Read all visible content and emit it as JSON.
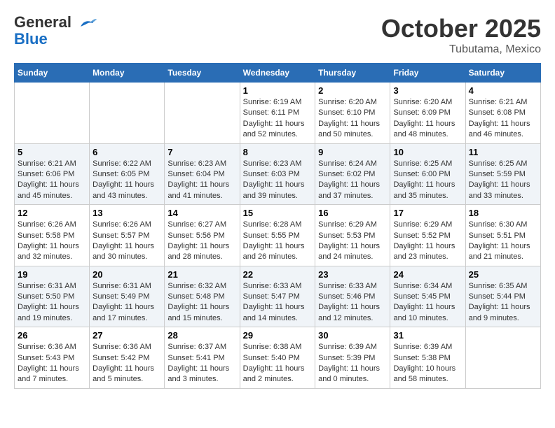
{
  "header": {
    "logo_line1": "General",
    "logo_line2": "Blue",
    "month": "October 2025",
    "location": "Tubutama, Mexico"
  },
  "weekdays": [
    "Sunday",
    "Monday",
    "Tuesday",
    "Wednesday",
    "Thursday",
    "Friday",
    "Saturday"
  ],
  "weeks": [
    [
      {
        "day": "",
        "info": ""
      },
      {
        "day": "",
        "info": ""
      },
      {
        "day": "",
        "info": ""
      },
      {
        "day": "1",
        "info": "Sunrise: 6:19 AM\nSunset: 6:11 PM\nDaylight: 11 hours\nand 52 minutes."
      },
      {
        "day": "2",
        "info": "Sunrise: 6:20 AM\nSunset: 6:10 PM\nDaylight: 11 hours\nand 50 minutes."
      },
      {
        "day": "3",
        "info": "Sunrise: 6:20 AM\nSunset: 6:09 PM\nDaylight: 11 hours\nand 48 minutes."
      },
      {
        "day": "4",
        "info": "Sunrise: 6:21 AM\nSunset: 6:08 PM\nDaylight: 11 hours\nand 46 minutes."
      }
    ],
    [
      {
        "day": "5",
        "info": "Sunrise: 6:21 AM\nSunset: 6:06 PM\nDaylight: 11 hours\nand 45 minutes."
      },
      {
        "day": "6",
        "info": "Sunrise: 6:22 AM\nSunset: 6:05 PM\nDaylight: 11 hours\nand 43 minutes."
      },
      {
        "day": "7",
        "info": "Sunrise: 6:23 AM\nSunset: 6:04 PM\nDaylight: 11 hours\nand 41 minutes."
      },
      {
        "day": "8",
        "info": "Sunrise: 6:23 AM\nSunset: 6:03 PM\nDaylight: 11 hours\nand 39 minutes."
      },
      {
        "day": "9",
        "info": "Sunrise: 6:24 AM\nSunset: 6:02 PM\nDaylight: 11 hours\nand 37 minutes."
      },
      {
        "day": "10",
        "info": "Sunrise: 6:25 AM\nSunset: 6:00 PM\nDaylight: 11 hours\nand 35 minutes."
      },
      {
        "day": "11",
        "info": "Sunrise: 6:25 AM\nSunset: 5:59 PM\nDaylight: 11 hours\nand 33 minutes."
      }
    ],
    [
      {
        "day": "12",
        "info": "Sunrise: 6:26 AM\nSunset: 5:58 PM\nDaylight: 11 hours\nand 32 minutes."
      },
      {
        "day": "13",
        "info": "Sunrise: 6:26 AM\nSunset: 5:57 PM\nDaylight: 11 hours\nand 30 minutes."
      },
      {
        "day": "14",
        "info": "Sunrise: 6:27 AM\nSunset: 5:56 PM\nDaylight: 11 hours\nand 28 minutes."
      },
      {
        "day": "15",
        "info": "Sunrise: 6:28 AM\nSunset: 5:55 PM\nDaylight: 11 hours\nand 26 minutes."
      },
      {
        "day": "16",
        "info": "Sunrise: 6:29 AM\nSunset: 5:53 PM\nDaylight: 11 hours\nand 24 minutes."
      },
      {
        "day": "17",
        "info": "Sunrise: 6:29 AM\nSunset: 5:52 PM\nDaylight: 11 hours\nand 23 minutes."
      },
      {
        "day": "18",
        "info": "Sunrise: 6:30 AM\nSunset: 5:51 PM\nDaylight: 11 hours\nand 21 minutes."
      }
    ],
    [
      {
        "day": "19",
        "info": "Sunrise: 6:31 AM\nSunset: 5:50 PM\nDaylight: 11 hours\nand 19 minutes."
      },
      {
        "day": "20",
        "info": "Sunrise: 6:31 AM\nSunset: 5:49 PM\nDaylight: 11 hours\nand 17 minutes."
      },
      {
        "day": "21",
        "info": "Sunrise: 6:32 AM\nSunset: 5:48 PM\nDaylight: 11 hours\nand 15 minutes."
      },
      {
        "day": "22",
        "info": "Sunrise: 6:33 AM\nSunset: 5:47 PM\nDaylight: 11 hours\nand 14 minutes."
      },
      {
        "day": "23",
        "info": "Sunrise: 6:33 AM\nSunset: 5:46 PM\nDaylight: 11 hours\nand 12 minutes."
      },
      {
        "day": "24",
        "info": "Sunrise: 6:34 AM\nSunset: 5:45 PM\nDaylight: 11 hours\nand 10 minutes."
      },
      {
        "day": "25",
        "info": "Sunrise: 6:35 AM\nSunset: 5:44 PM\nDaylight: 11 hours\nand 9 minutes."
      }
    ],
    [
      {
        "day": "26",
        "info": "Sunrise: 6:36 AM\nSunset: 5:43 PM\nDaylight: 11 hours\nand 7 minutes."
      },
      {
        "day": "27",
        "info": "Sunrise: 6:36 AM\nSunset: 5:42 PM\nDaylight: 11 hours\nand 5 minutes."
      },
      {
        "day": "28",
        "info": "Sunrise: 6:37 AM\nSunset: 5:41 PM\nDaylight: 11 hours\nand 3 minutes."
      },
      {
        "day": "29",
        "info": "Sunrise: 6:38 AM\nSunset: 5:40 PM\nDaylight: 11 hours\nand 2 minutes."
      },
      {
        "day": "30",
        "info": "Sunrise: 6:39 AM\nSunset: 5:39 PM\nDaylight: 11 hours\nand 0 minutes."
      },
      {
        "day": "31",
        "info": "Sunrise: 6:39 AM\nSunset: 5:38 PM\nDaylight: 10 hours\nand 58 minutes."
      },
      {
        "day": "",
        "info": ""
      }
    ]
  ]
}
